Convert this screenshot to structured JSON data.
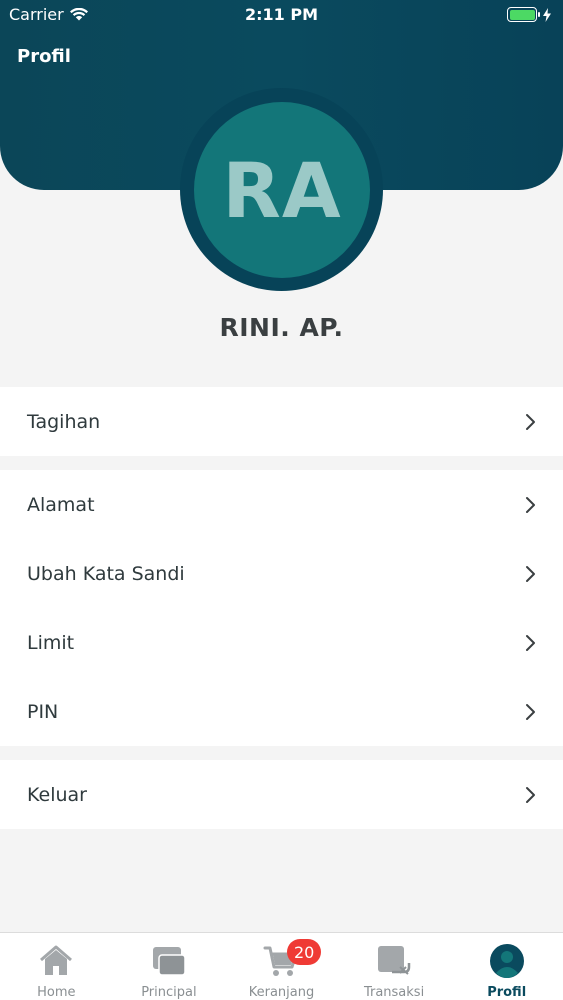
{
  "status_bar": {
    "carrier": "Carrier",
    "time": "2:11 PM"
  },
  "header": {
    "title": "Profil"
  },
  "profile": {
    "initials": "RA",
    "name": "RINI. AP."
  },
  "menu": {
    "group1": [
      {
        "label": "Tagihan"
      }
    ],
    "group2": [
      {
        "label": "Alamat"
      },
      {
        "label": "Ubah Kata Sandi"
      },
      {
        "label": "Limit"
      },
      {
        "label": "PIN"
      }
    ],
    "group3": [
      {
        "label": "Keluar"
      }
    ]
  },
  "tabbar": {
    "items": [
      {
        "label": "Home",
        "icon": "home-icon"
      },
      {
        "label": "Principal",
        "icon": "principal-icon"
      },
      {
        "label": "Keranjang",
        "icon": "cart-icon",
        "badge": "20"
      },
      {
        "label": "Transaksi",
        "icon": "transaction-icon"
      },
      {
        "label": "Profil",
        "icon": "profile-icon",
        "active": true
      }
    ]
  },
  "colors": {
    "header": "#0a4a5e",
    "avatar": "#137679",
    "badge": "#ef3a35",
    "battery": "#4cd964"
  }
}
